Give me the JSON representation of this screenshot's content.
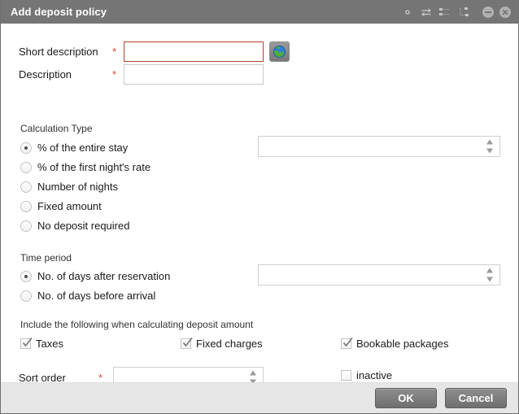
{
  "window": {
    "title": "Add deposit policy",
    "tools": [
      {
        "name": "settings-gear-icon",
        "label": "Settings"
      },
      {
        "name": "exchange-arrows-icon",
        "label": "Exchange"
      },
      {
        "name": "list-tree-icon",
        "label": "List tree"
      },
      {
        "name": "hierarchy-icon",
        "label": "Hierarchy"
      }
    ],
    "controls": [
      {
        "name": "minimize-button",
        "label": "Minimize"
      },
      {
        "name": "close-button",
        "label": "Close"
      }
    ]
  },
  "form": {
    "short_description": {
      "label": "Short description",
      "required_marker": "*",
      "value": "",
      "placeholder": "",
      "has_error": true,
      "translate_button": "globe-icon"
    },
    "description": {
      "label": "Description",
      "required_marker": "*",
      "value": "",
      "placeholder": ""
    },
    "calculation_type": {
      "legend": "Calculation Type",
      "options": [
        {
          "label": "% of the entire stay",
          "selected": true
        },
        {
          "label": "% of the first night's rate",
          "selected": false
        },
        {
          "label": "Number of nights",
          "selected": false
        },
        {
          "label": "Fixed amount",
          "selected": false
        },
        {
          "label": "No deposit required",
          "selected": false
        }
      ],
      "amount_value": "",
      "amount_placeholder": ""
    },
    "time_period": {
      "legend": "Time period",
      "options": [
        {
          "label": "No. of days after reservation",
          "selected": true
        },
        {
          "label": "No. of days before arrival",
          "selected": false
        }
      ],
      "days_value": "",
      "days_placeholder": ""
    },
    "include_section": {
      "legend": "Include the following when calculating deposit amount",
      "items": [
        {
          "label": "Taxes",
          "checked": true
        },
        {
          "label": "Fixed charges",
          "checked": true
        },
        {
          "label": "Bookable packages",
          "checked": true
        }
      ]
    },
    "sort_order": {
      "label": "Sort order",
      "required_marker": "*",
      "value": "",
      "placeholder": ""
    },
    "inactive": {
      "label": "inactive",
      "checked": false
    }
  },
  "footer": {
    "ok_label": "OK",
    "cancel_label": "Cancel"
  },
  "colors": {
    "titlebar": "#757575",
    "footer": "#e6e6e6",
    "error_border": "#b5402a",
    "required_asterisk": "#e8422e",
    "button": "#7c7c7c"
  }
}
